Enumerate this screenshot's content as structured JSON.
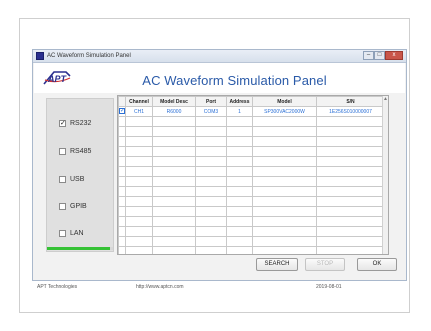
{
  "window": {
    "title": "AC Waveform Simulation Panel",
    "controls": {
      "minimize": "–",
      "maximize": "□",
      "close": "x"
    }
  },
  "header": {
    "logo_text": "APT",
    "title": "AC Waveform Simulation Panel"
  },
  "interfaces": [
    {
      "label": "RS232",
      "checked": true
    },
    {
      "label": "RS485",
      "checked": false
    },
    {
      "label": "USB",
      "checked": false
    },
    {
      "label": "GPIB",
      "checked": false
    },
    {
      "label": "LAN",
      "checked": false
    }
  ],
  "progress": {
    "fraction": 0.95
  },
  "table": {
    "columns": [
      "",
      "Channel",
      "Model Desc",
      "Port",
      "Address",
      "Model",
      "S/N"
    ],
    "rows": [
      [
        "☑",
        "CH1",
        "R6000",
        "COM3",
        "1",
        "SP300VAC2000W",
        "1E256S010000007"
      ]
    ],
    "empty_rows": 15
  },
  "buttons": {
    "search": "SEARCH",
    "stop": "STOP",
    "ok": "OK"
  },
  "footer": {
    "left": "APT Technologies",
    "center": "http://www.aptcn.com",
    "right": "2019-08-01"
  },
  "colors": {
    "title_blue": "#2a5aa8",
    "cell_blue": "#2a6fd6",
    "progress_green": "#35c235",
    "close_red": "#c9564a"
  }
}
